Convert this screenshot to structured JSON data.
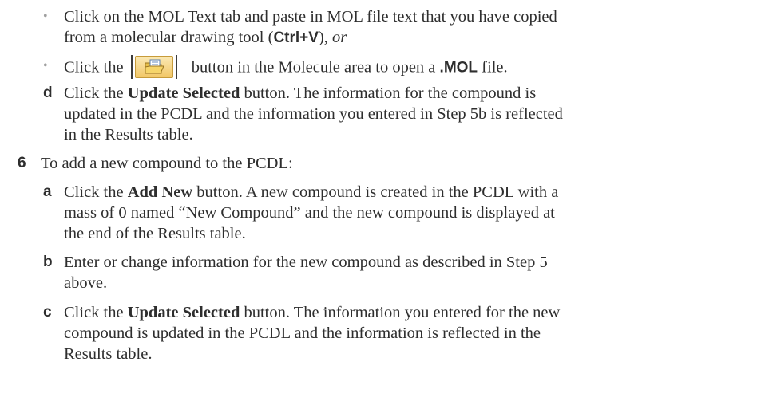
{
  "bullet_glyph": "•",
  "bullet1": {
    "line1_a": "Click on the MOL Text tab and paste in MOL file text that you have copied",
    "line2_a": "from a molecular drawing tool (",
    "line2_shortcut": "Ctrl+V",
    "line2_b": "),",
    "line2_or": "or"
  },
  "bullet2": {
    "a": "Click the",
    "button_icon": "open-folder-icon",
    "b": "button in the Molecule area to open a",
    "ext": ".MOL",
    "c": "file."
  },
  "step_d": {
    "marker": "d",
    "line1_a": "Click the",
    "line1_bold": "Update Selected",
    "line1_b": "button. The information for the compound is",
    "line2": "updated in the PCDL and the information you entered in Step 5b is reflected",
    "line3": "in the Results table."
  },
  "step6": {
    "marker": "6",
    "text": "To add a new compound to the PCDL:"
  },
  "step_a": {
    "marker": "a",
    "line1_a": "Click the",
    "line1_bold": "Add New",
    "line1_b": "button. A new compound is created in the PCDL with a",
    "line2": "mass of 0 named “New Compound” and the new compound is displayed at",
    "line3": "the end of the Results table."
  },
  "step_b": {
    "marker": "b",
    "line1": "Enter or change information for the new compound as described in Step 5",
    "line2": "above."
  },
  "step_c": {
    "marker": "c",
    "line1_a": "Click the",
    "line1_bold": "Update Selected",
    "line1_b": "button. The information you entered for the new",
    "line2": "compound is updated in the PCDL and the information is reflected in the",
    "line3": "Results table."
  },
  "colors": {
    "text": "#2e2e2e",
    "bullet": "#a0a0a0",
    "button_face": "#f2c766"
  }
}
